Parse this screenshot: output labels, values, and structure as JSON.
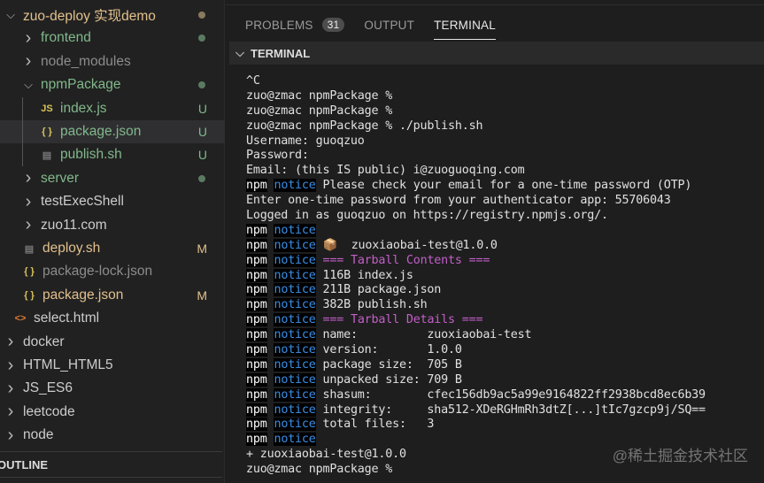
{
  "sidebar": {
    "items": [
      {
        "label": "zuo-deploy 实现demo",
        "kind": "folder-open",
        "indent": 0,
        "color": "#e2c08d",
        "dot": "#8a7a5e"
      },
      {
        "label": "frontend",
        "kind": "folder",
        "indent": 1,
        "color": "#81b88b",
        "dot": "#5b7a62"
      },
      {
        "label": "node_modules",
        "kind": "folder",
        "indent": 1,
        "color": "#8c8c8c"
      },
      {
        "label": "npmPackage",
        "kind": "folder-open",
        "indent": 1,
        "color": "#81b88b",
        "dot": "#5b7a62"
      },
      {
        "label": "index.js",
        "kind": "js",
        "indent": 2,
        "color": "#81b88b",
        "badge": "U"
      },
      {
        "label": "package.json",
        "kind": "json",
        "indent": 2,
        "color": "#81b88b",
        "badge": "U",
        "selected": true
      },
      {
        "label": "publish.sh",
        "kind": "sh",
        "indent": 2,
        "color": "#81b88b",
        "badge": "U"
      },
      {
        "label": "server",
        "kind": "folder",
        "indent": 1,
        "color": "#81b88b",
        "dot": "#5b7a62"
      },
      {
        "label": "testExecShell",
        "kind": "folder",
        "indent": 1,
        "color": "#cccccc"
      },
      {
        "label": "zuo11.com",
        "kind": "folder",
        "indent": 1,
        "color": "#cccccc"
      },
      {
        "label": "deploy.sh",
        "kind": "sh",
        "indent": 1,
        "color": "#e2c08d",
        "badge": "M"
      },
      {
        "label": "package-lock.json",
        "kind": "json",
        "indent": 1,
        "color": "#8c8c8c"
      },
      {
        "label": "package.json",
        "kind": "json",
        "indent": 1,
        "color": "#e2c08d",
        "badge": "M"
      },
      {
        "label": "select.html",
        "kind": "html",
        "indent": 0.5,
        "color": "#cccccc"
      },
      {
        "label": "docker",
        "kind": "folder",
        "indent": 0,
        "color": "#cccccc"
      },
      {
        "label": "HTML_HTML5",
        "kind": "folder",
        "indent": 0,
        "color": "#cccccc"
      },
      {
        "label": "JS_ES6",
        "kind": "folder",
        "indent": 0,
        "color": "#cccccc"
      },
      {
        "label": "leetcode",
        "kind": "folder",
        "indent": 0,
        "color": "#cccccc"
      },
      {
        "label": "node",
        "kind": "folder",
        "indent": 0,
        "color": "#cccccc"
      }
    ],
    "outline_label": "OUTLINE"
  },
  "tabs": {
    "problems": "PROBLEMS",
    "problems_count": "31",
    "output": "OUTPUT",
    "terminal": "TERMINAL"
  },
  "terminal_header": "TERMINAL",
  "terminal_lines": [
    [
      [
        "t",
        "^C"
      ]
    ],
    [
      [
        "t",
        "zuo@zmac npmPackage %"
      ]
    ],
    [
      [
        "t",
        "zuo@zmac npmPackage %"
      ]
    ],
    [
      [
        "t",
        "zuo@zmac npmPackage % ./publish.sh"
      ]
    ],
    [
      [
        "t",
        "Username: guoqzuo"
      ]
    ],
    [
      [
        "t",
        "Password:"
      ]
    ],
    [
      [
        "t",
        "Email: (this IS public) i@zuoguoqing.com"
      ]
    ],
    [
      [
        "n",
        "npm"
      ],
      [
        "t",
        " "
      ],
      [
        "o",
        "notice"
      ],
      [
        "t",
        " Please check your email for a one-time password (OTP)"
      ]
    ],
    [
      [
        "t",
        "Enter one-time password from your authenticator app: 55706043"
      ]
    ],
    [
      [
        "t",
        "Logged in as guoqzuo on https://registry.npmjs.org/."
      ]
    ],
    [
      [
        "n",
        "npm"
      ],
      [
        "t",
        " "
      ],
      [
        "o",
        "notice"
      ]
    ],
    [
      [
        "n",
        "npm"
      ],
      [
        "t",
        " "
      ],
      [
        "o",
        "notice"
      ],
      [
        "t",
        " 📦  zuoxiaobai-test@1.0.0"
      ]
    ],
    [
      [
        "n",
        "npm"
      ],
      [
        "t",
        " "
      ],
      [
        "o",
        "notice"
      ],
      [
        "t",
        " "
      ],
      [
        "p",
        "=== Tarball Contents ==="
      ]
    ],
    [
      [
        "n",
        "npm"
      ],
      [
        "t",
        " "
      ],
      [
        "o",
        "notice"
      ],
      [
        "t",
        " 116B index.js"
      ]
    ],
    [
      [
        "n",
        "npm"
      ],
      [
        "t",
        " "
      ],
      [
        "o",
        "notice"
      ],
      [
        "t",
        " 211B package.json"
      ]
    ],
    [
      [
        "n",
        "npm"
      ],
      [
        "t",
        " "
      ],
      [
        "o",
        "notice"
      ],
      [
        "t",
        " 382B publish.sh"
      ]
    ],
    [
      [
        "n",
        "npm"
      ],
      [
        "t",
        " "
      ],
      [
        "o",
        "notice"
      ],
      [
        "t",
        " "
      ],
      [
        "p",
        "=== Tarball Details ==="
      ]
    ],
    [
      [
        "n",
        "npm"
      ],
      [
        "t",
        " "
      ],
      [
        "o",
        "notice"
      ],
      [
        "t",
        " name:          zuoxiaobai-test"
      ]
    ],
    [
      [
        "n",
        "npm"
      ],
      [
        "t",
        " "
      ],
      [
        "o",
        "notice"
      ],
      [
        "t",
        " version:       1.0.0"
      ]
    ],
    [
      [
        "n",
        "npm"
      ],
      [
        "t",
        " "
      ],
      [
        "o",
        "notice"
      ],
      [
        "t",
        " package size:  705 B"
      ]
    ],
    [
      [
        "n",
        "npm"
      ],
      [
        "t",
        " "
      ],
      [
        "o",
        "notice"
      ],
      [
        "t",
        " unpacked size: 709 B"
      ]
    ],
    [
      [
        "n",
        "npm"
      ],
      [
        "t",
        " "
      ],
      [
        "o",
        "notice"
      ],
      [
        "t",
        " shasum:        cfec156db9ac5a99e9164822ff2938bcd8ec6b39"
      ]
    ],
    [
      [
        "n",
        "npm"
      ],
      [
        "t",
        " "
      ],
      [
        "o",
        "notice"
      ],
      [
        "t",
        " integrity:     sha512-XDeRGHmRh3dtZ[...]tIc7gzcp9j/SQ=="
      ]
    ],
    [
      [
        "n",
        "npm"
      ],
      [
        "t",
        " "
      ],
      [
        "o",
        "notice"
      ],
      [
        "t",
        " total files:   3"
      ]
    ],
    [
      [
        "n",
        "npm"
      ],
      [
        "t",
        " "
      ],
      [
        "o",
        "notice"
      ]
    ],
    [
      [
        "t",
        "+ zuoxiaobai-test@1.0.0"
      ]
    ],
    [
      [
        "t",
        "zuo@zmac npmPackage %"
      ]
    ]
  ],
  "watermark": "@稀土掘金技术社区"
}
